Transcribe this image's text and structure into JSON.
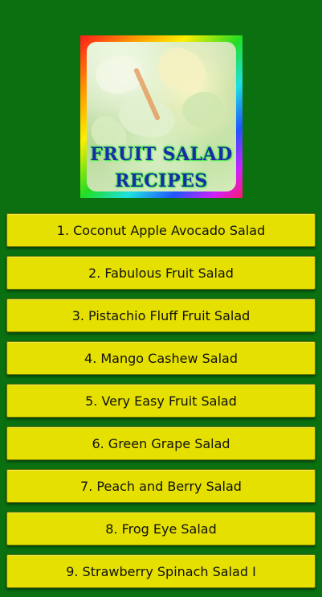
{
  "logo": {
    "title_line1": "FRUIT SALAD",
    "title_line2": "RECIPES"
  },
  "recipes": [
    "1. Coconut Apple Avocado Salad",
    "2. Fabulous Fruit Salad",
    "3. Pistachio Fluff Fruit Salad",
    "4. Mango Cashew Salad",
    "5. Very Easy Fruit Salad",
    "6. Green Grape Salad",
    "7. Peach and Berry Salad",
    "8. Frog Eye Salad",
    "9. Strawberry Spinach Salad I"
  ],
  "colors": {
    "background": "#0a7010",
    "button": "#e5e000",
    "title_text": "#1a2aa8"
  }
}
